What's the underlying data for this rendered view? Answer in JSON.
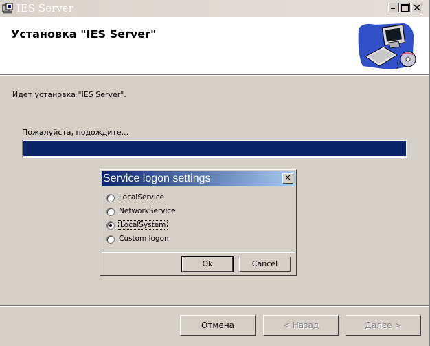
{
  "window": {
    "title": "IES Server",
    "controls": {
      "minimize": "_",
      "maximize": "□",
      "close": "✕"
    }
  },
  "header": {
    "title": "Установка \"IES Server\""
  },
  "main": {
    "status": "Идет установка \"IES Server\".",
    "wait_label": "Пожалуйста, подождите...",
    "progress_fraction": 1.0
  },
  "dialog": {
    "title": "Service logon settings",
    "close_glyph": "✕",
    "options": [
      {
        "label": "LocalService",
        "selected": false
      },
      {
        "label": "NetworkService",
        "selected": false
      },
      {
        "label": "LocalSystem",
        "selected": true
      },
      {
        "label": "Custom logon",
        "selected": false
      }
    ],
    "ok_label": "Ok",
    "cancel_label": "Cancel"
  },
  "footer": {
    "cancel_label": "Отмена",
    "back_label": "< Назад",
    "next_label": "Далее >"
  },
  "colors": {
    "progress": "#0a246a",
    "dialog_title": "#0a246a"
  }
}
